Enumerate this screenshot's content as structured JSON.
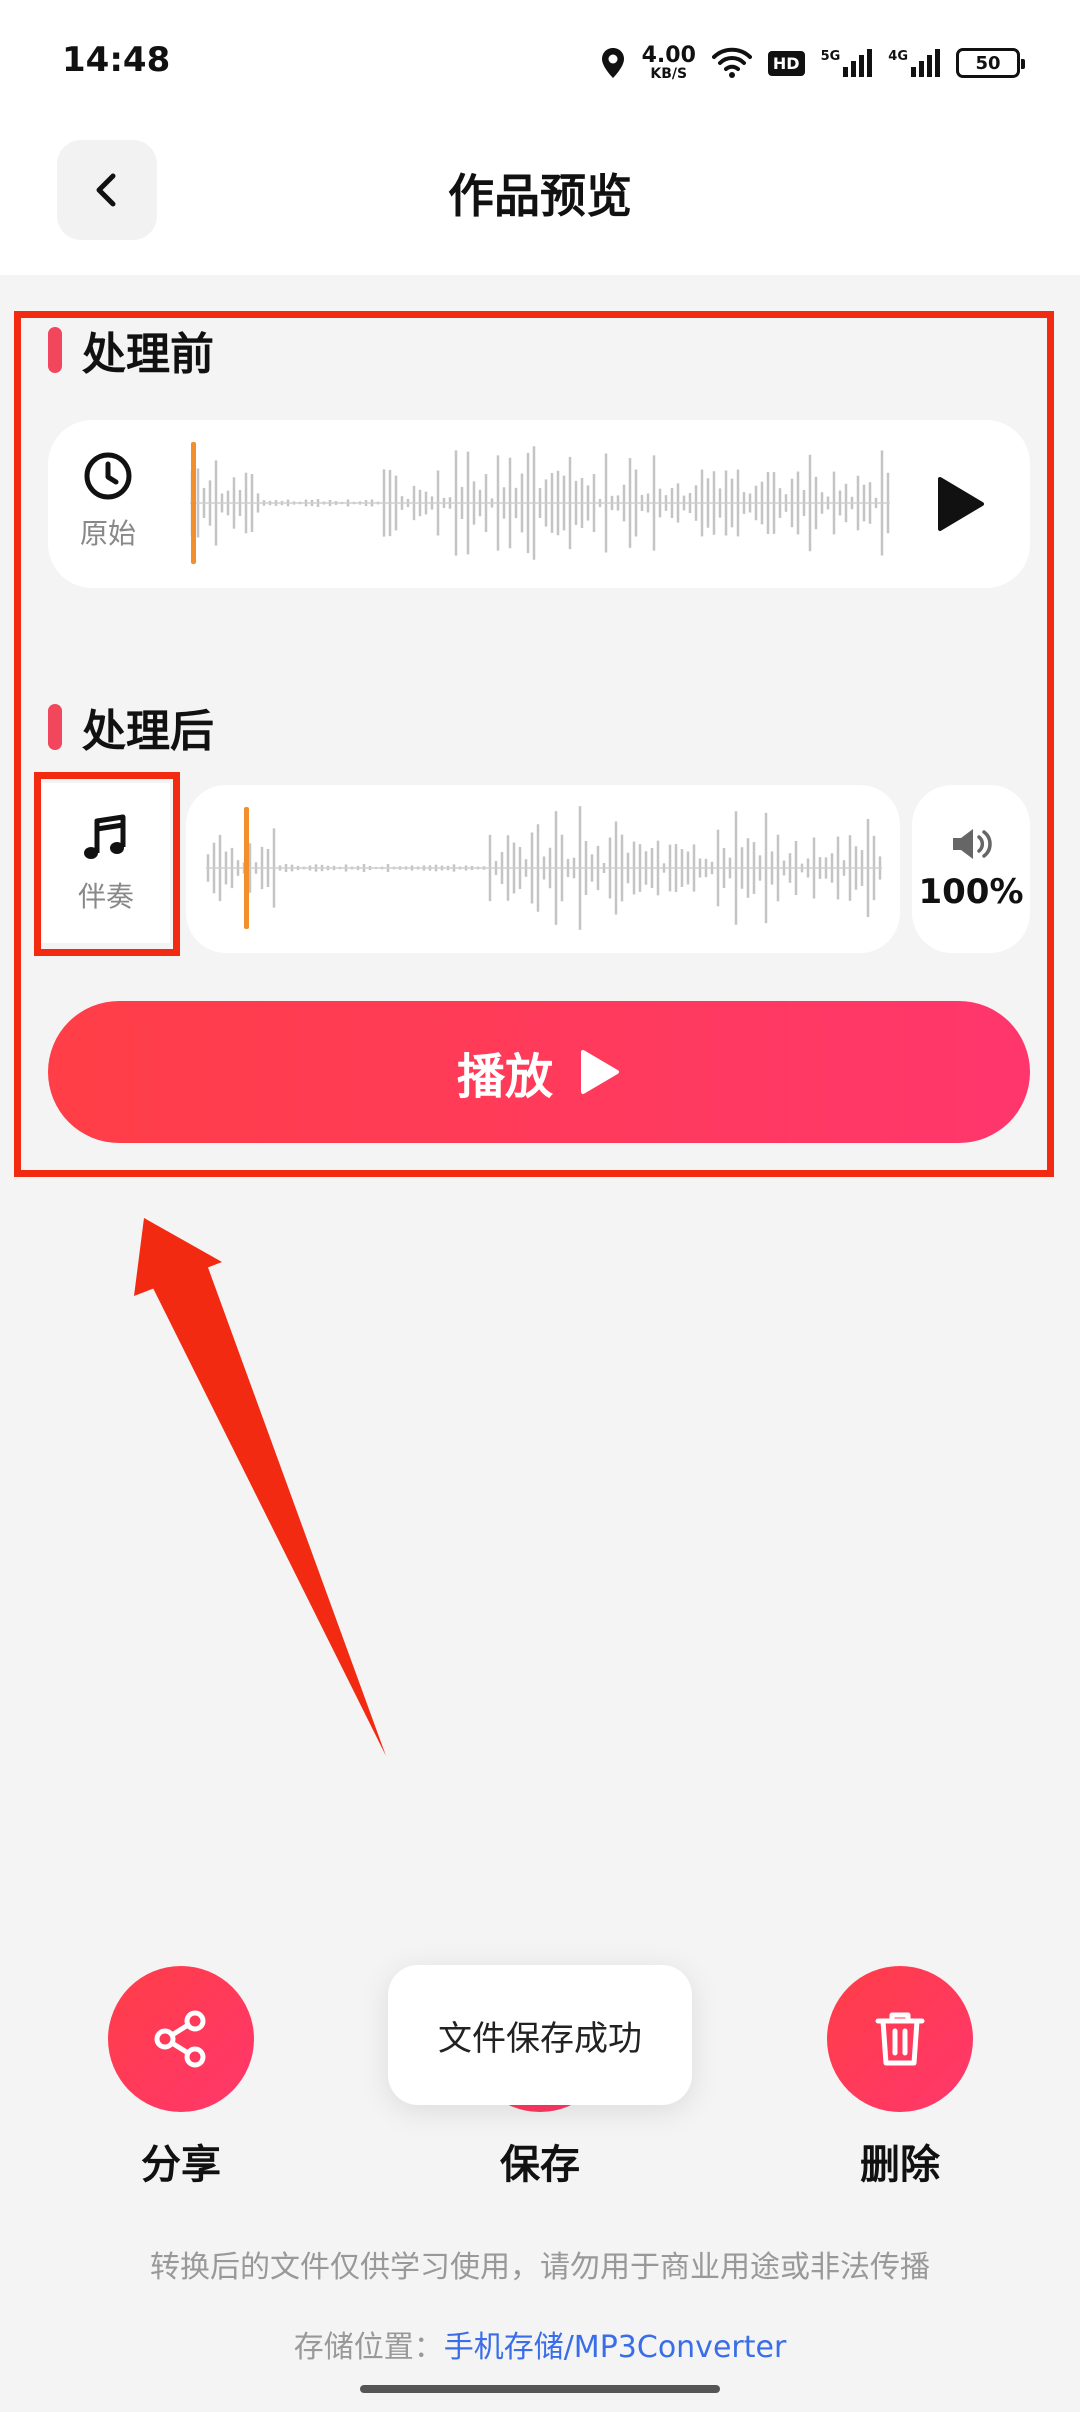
{
  "status_bar": {
    "time": "14:48",
    "net_speed_value": "4.00",
    "net_speed_unit": "KB/S",
    "hd_label": "HD",
    "sim1_label": "5G",
    "sim2_label": "4G",
    "battery": "50",
    "icons": [
      "location-icon",
      "wifi-icon",
      "hd-icon",
      "signal-icon",
      "signal-icon",
      "battery-icon"
    ]
  },
  "header": {
    "title": "作品预览",
    "back_icon": "chevron-left-icon"
  },
  "before": {
    "title": "处理前",
    "track_label": "原始",
    "track_icon": "clock-icon",
    "play_icon": "play-icon"
  },
  "after": {
    "title": "处理后",
    "track_label": "伴奏",
    "track_icon": "music-note-icon",
    "volume": "100%",
    "volume_icon": "volume-icon"
  },
  "play_button": {
    "label": "播放",
    "icon": "play-icon"
  },
  "actions": [
    {
      "label": "分享",
      "icon": "share-icon"
    },
    {
      "label": "保存",
      "icon": "save-icon"
    },
    {
      "label": "删除",
      "icon": "trash-icon"
    }
  ],
  "toast": "文件保存成功",
  "footer": {
    "disclaimer": "转换后的文件仅供学习使用，请勿用于商业用途或非法传播",
    "storage_label": "存储位置：",
    "storage_path": "手机存储/MP3Converter"
  },
  "colors": {
    "accent": "#ff3a55",
    "annotation": "#f22a11",
    "playhead": "#f28f2c",
    "link": "#3a6ee8"
  }
}
